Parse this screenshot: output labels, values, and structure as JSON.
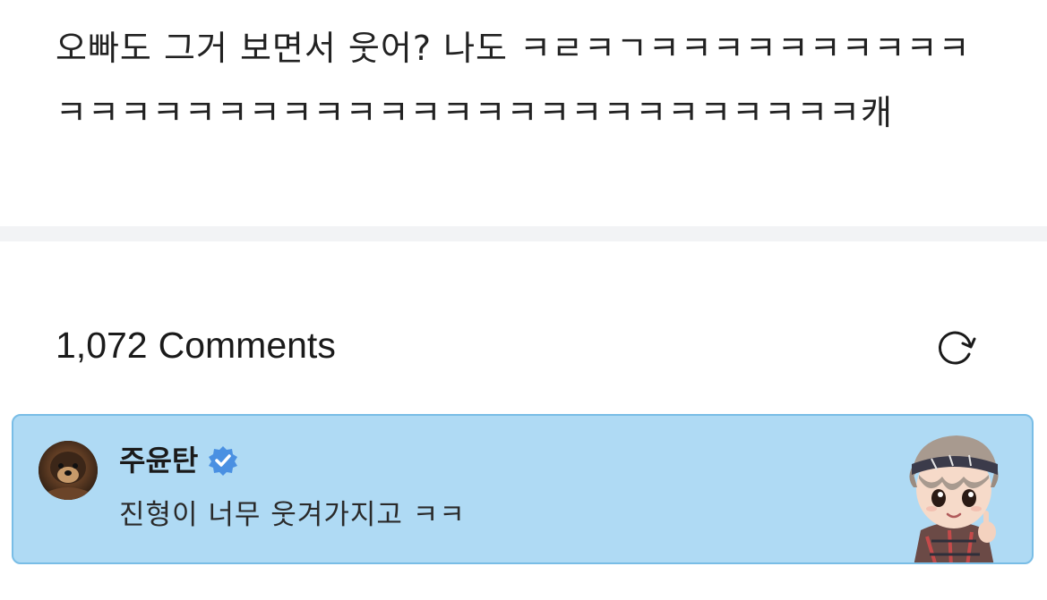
{
  "post": {
    "body": "오빠도 그거 보면서 웃어? 나도 ㅋㄹㅋㄱㅋㅋㅋㅋㅋㅋㅋㅋㅋㅋㅋㅋㅋㅋㅋㅋㅋㅋㅋㅋㅋㅋㅋㅋㅋㅋㅋㅋㅋㅋㅋㅋㅋㅋㅋ캐"
  },
  "comments_header": {
    "count": "1,072",
    "label": "Comments",
    "refresh_icon": "refresh-icon"
  },
  "comment": {
    "author": "주윤탄",
    "verified_icon": "verified-badge-icon",
    "text": "진형이 너무 웃겨가지고 ㅋㅋ",
    "sticker": "character-sticker",
    "background_color": "#afdaf4",
    "border_color": "#79bde6"
  },
  "colors": {
    "separator": "#f2f3f5",
    "verified_badge": "#4a90e2"
  }
}
